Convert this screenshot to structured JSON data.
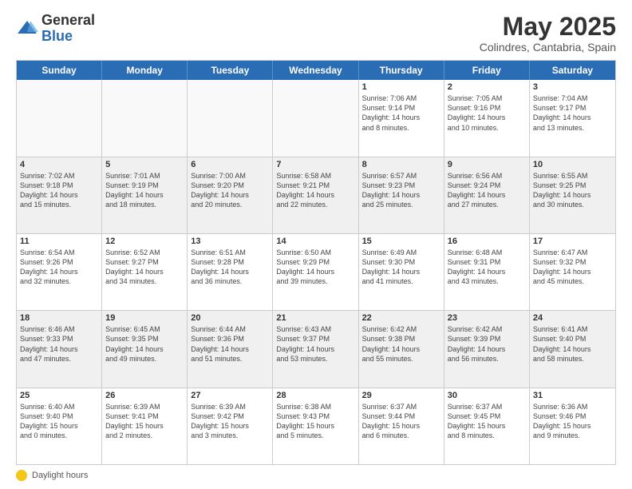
{
  "header": {
    "logo_general": "General",
    "logo_blue": "Blue",
    "month_title": "May 2025",
    "subtitle": "Colindres, Cantabria, Spain"
  },
  "calendar": {
    "days_of_week": [
      "Sunday",
      "Monday",
      "Tuesday",
      "Wednesday",
      "Thursday",
      "Friday",
      "Saturday"
    ],
    "rows": [
      [
        {
          "day": "",
          "info": "",
          "empty": true
        },
        {
          "day": "",
          "info": "",
          "empty": true
        },
        {
          "day": "",
          "info": "",
          "empty": true
        },
        {
          "day": "",
          "info": "",
          "empty": true
        },
        {
          "day": "1",
          "info": "Sunrise: 7:06 AM\nSunset: 9:14 PM\nDaylight: 14 hours\nand 8 minutes."
        },
        {
          "day": "2",
          "info": "Sunrise: 7:05 AM\nSunset: 9:16 PM\nDaylight: 14 hours\nand 10 minutes."
        },
        {
          "day": "3",
          "info": "Sunrise: 7:04 AM\nSunset: 9:17 PM\nDaylight: 14 hours\nand 13 minutes."
        }
      ],
      [
        {
          "day": "4",
          "info": "Sunrise: 7:02 AM\nSunset: 9:18 PM\nDaylight: 14 hours\nand 15 minutes."
        },
        {
          "day": "5",
          "info": "Sunrise: 7:01 AM\nSunset: 9:19 PM\nDaylight: 14 hours\nand 18 minutes."
        },
        {
          "day": "6",
          "info": "Sunrise: 7:00 AM\nSunset: 9:20 PM\nDaylight: 14 hours\nand 20 minutes."
        },
        {
          "day": "7",
          "info": "Sunrise: 6:58 AM\nSunset: 9:21 PM\nDaylight: 14 hours\nand 22 minutes."
        },
        {
          "day": "8",
          "info": "Sunrise: 6:57 AM\nSunset: 9:23 PM\nDaylight: 14 hours\nand 25 minutes."
        },
        {
          "day": "9",
          "info": "Sunrise: 6:56 AM\nSunset: 9:24 PM\nDaylight: 14 hours\nand 27 minutes."
        },
        {
          "day": "10",
          "info": "Sunrise: 6:55 AM\nSunset: 9:25 PM\nDaylight: 14 hours\nand 30 minutes."
        }
      ],
      [
        {
          "day": "11",
          "info": "Sunrise: 6:54 AM\nSunset: 9:26 PM\nDaylight: 14 hours\nand 32 minutes."
        },
        {
          "day": "12",
          "info": "Sunrise: 6:52 AM\nSunset: 9:27 PM\nDaylight: 14 hours\nand 34 minutes."
        },
        {
          "day": "13",
          "info": "Sunrise: 6:51 AM\nSunset: 9:28 PM\nDaylight: 14 hours\nand 36 minutes."
        },
        {
          "day": "14",
          "info": "Sunrise: 6:50 AM\nSunset: 9:29 PM\nDaylight: 14 hours\nand 39 minutes."
        },
        {
          "day": "15",
          "info": "Sunrise: 6:49 AM\nSunset: 9:30 PM\nDaylight: 14 hours\nand 41 minutes."
        },
        {
          "day": "16",
          "info": "Sunrise: 6:48 AM\nSunset: 9:31 PM\nDaylight: 14 hours\nand 43 minutes."
        },
        {
          "day": "17",
          "info": "Sunrise: 6:47 AM\nSunset: 9:32 PM\nDaylight: 14 hours\nand 45 minutes."
        }
      ],
      [
        {
          "day": "18",
          "info": "Sunrise: 6:46 AM\nSunset: 9:33 PM\nDaylight: 14 hours\nand 47 minutes."
        },
        {
          "day": "19",
          "info": "Sunrise: 6:45 AM\nSunset: 9:35 PM\nDaylight: 14 hours\nand 49 minutes."
        },
        {
          "day": "20",
          "info": "Sunrise: 6:44 AM\nSunset: 9:36 PM\nDaylight: 14 hours\nand 51 minutes."
        },
        {
          "day": "21",
          "info": "Sunrise: 6:43 AM\nSunset: 9:37 PM\nDaylight: 14 hours\nand 53 minutes."
        },
        {
          "day": "22",
          "info": "Sunrise: 6:42 AM\nSunset: 9:38 PM\nDaylight: 14 hours\nand 55 minutes."
        },
        {
          "day": "23",
          "info": "Sunrise: 6:42 AM\nSunset: 9:39 PM\nDaylight: 14 hours\nand 56 minutes."
        },
        {
          "day": "24",
          "info": "Sunrise: 6:41 AM\nSunset: 9:40 PM\nDaylight: 14 hours\nand 58 minutes."
        }
      ],
      [
        {
          "day": "25",
          "info": "Sunrise: 6:40 AM\nSunset: 9:40 PM\nDaylight: 15 hours\nand 0 minutes."
        },
        {
          "day": "26",
          "info": "Sunrise: 6:39 AM\nSunset: 9:41 PM\nDaylight: 15 hours\nand 2 minutes."
        },
        {
          "day": "27",
          "info": "Sunrise: 6:39 AM\nSunset: 9:42 PM\nDaylight: 15 hours\nand 3 minutes."
        },
        {
          "day": "28",
          "info": "Sunrise: 6:38 AM\nSunset: 9:43 PM\nDaylight: 15 hours\nand 5 minutes."
        },
        {
          "day": "29",
          "info": "Sunrise: 6:37 AM\nSunset: 9:44 PM\nDaylight: 15 hours\nand 6 minutes."
        },
        {
          "day": "30",
          "info": "Sunrise: 6:37 AM\nSunset: 9:45 PM\nDaylight: 15 hours\nand 8 minutes."
        },
        {
          "day": "31",
          "info": "Sunrise: 6:36 AM\nSunset: 9:46 PM\nDaylight: 15 hours\nand 9 minutes."
        }
      ]
    ]
  },
  "footer": {
    "daylight_label": "Daylight hours"
  }
}
